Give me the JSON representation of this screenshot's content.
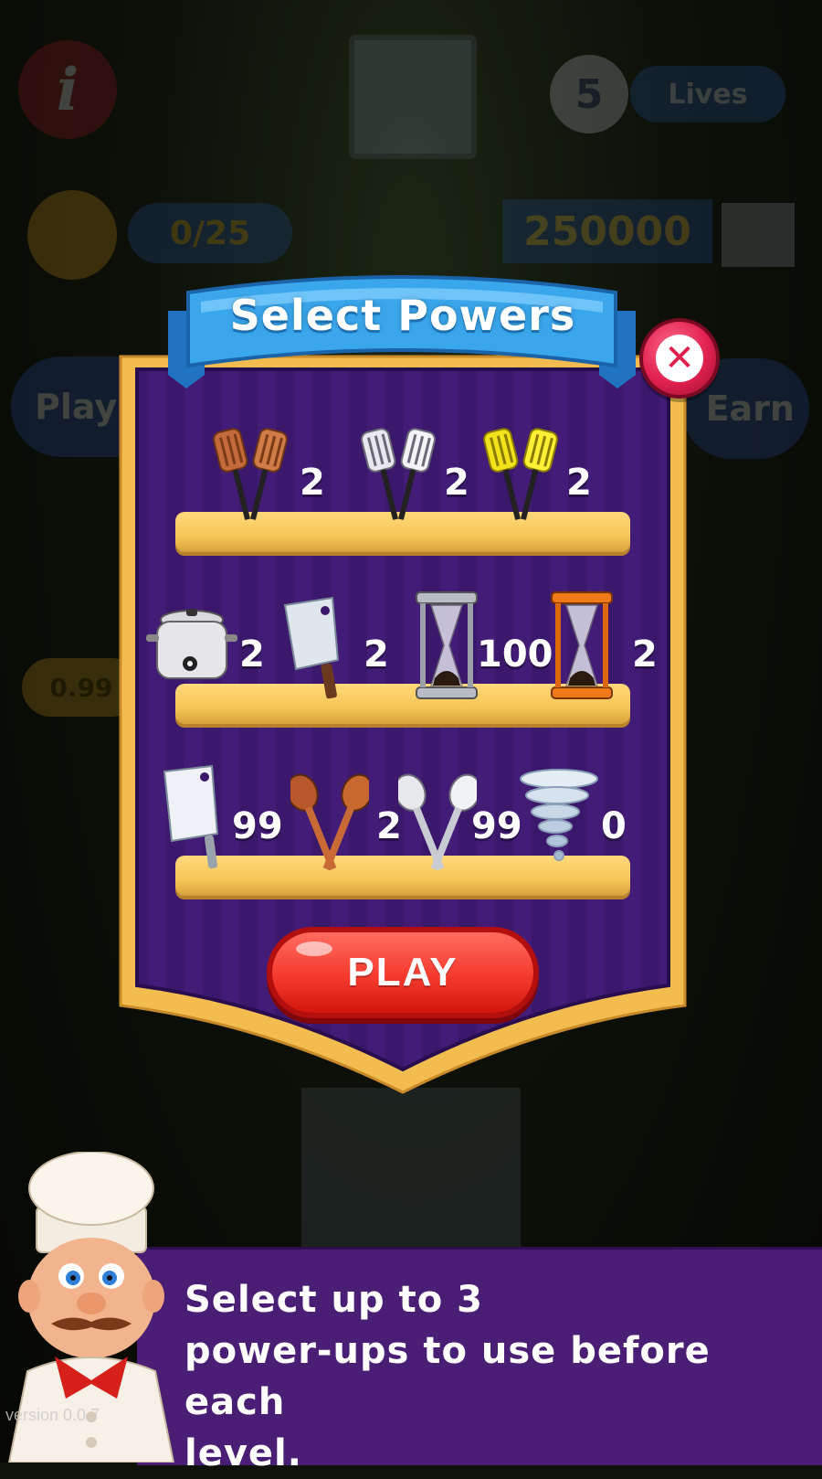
{
  "background": {
    "lives_count": "5",
    "lives_label": "Lives",
    "level_progress": "0/25",
    "score": "250000",
    "left_button": "Play",
    "right_button": "Earn",
    "price_tag": "0.99"
  },
  "dialog": {
    "title": "Select Powers",
    "close_icon": "close-x-icon",
    "play_label": "PLAY"
  },
  "powers": {
    "row1": [
      {
        "icon": "copper-spatulas-icon",
        "count": "2"
      },
      {
        "icon": "silver-spatulas-icon",
        "count": "2"
      },
      {
        "icon": "gold-spatulas-icon",
        "count": "2"
      }
    ],
    "row2": [
      {
        "icon": "rice-cooker-icon",
        "count": "2"
      },
      {
        "icon": "cleaver-icon",
        "count": "2"
      },
      {
        "icon": "silver-hourglass-icon",
        "count": "100"
      },
      {
        "icon": "orange-hourglass-icon",
        "count": "2"
      }
    ],
    "row3": [
      {
        "icon": "big-cleaver-icon",
        "count": "99"
      },
      {
        "icon": "wooden-spoons-icon",
        "count": "2"
      },
      {
        "icon": "silver-spoons-icon",
        "count": "99"
      },
      {
        "icon": "tornado-icon",
        "count": "0"
      }
    ]
  },
  "tutorial": {
    "text": "Select up to 3\npower-ups to use before each\nlevel."
  },
  "version": "version 0.0.7",
  "colors": {
    "panel_purple": "#3c1a6e",
    "panel_border": "#f2bd4e",
    "ribbon_blue": "#3aa7ec",
    "play_red": "#f43a2d",
    "close_pink": "#e02050",
    "shelf_yellow": "#f6c556"
  }
}
